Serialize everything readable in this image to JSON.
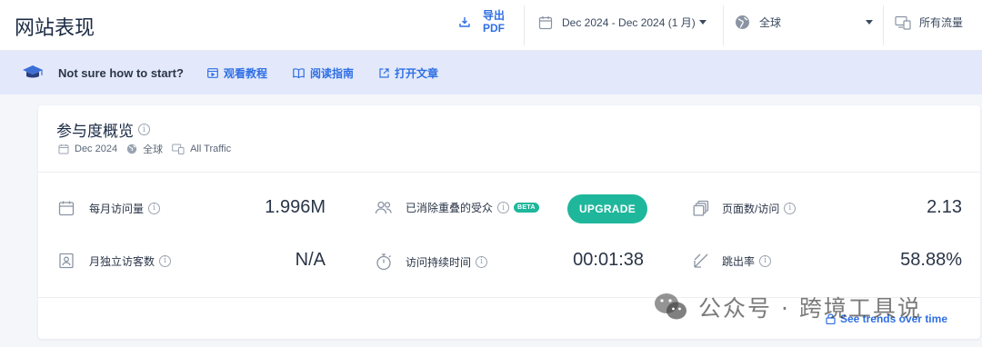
{
  "header": {
    "title": "网站表现",
    "export_label_line1": "导出",
    "export_label_line2": "PDF",
    "date_range": "Dec 2024 - Dec 2024 (1 月)",
    "country": "全球",
    "traffic": "所有流量"
  },
  "banner": {
    "question": "Not sure how to start?",
    "links": [
      "观看教程",
      "阅读指南",
      "打开文章"
    ]
  },
  "card": {
    "title": "参与度概览",
    "meta": {
      "date": "Dec 2024",
      "country": "全球",
      "traffic": "All Traffic"
    },
    "metrics": {
      "monthly_visits": {
        "label": "每月访问量",
        "value": "1.996M"
      },
      "unique_visitors": {
        "label": "月独立访客数",
        "value": "N/A"
      },
      "dedup_audience": {
        "label": "已消除重叠的受众",
        "badge": "BETA",
        "button": "UPGRADE"
      },
      "visit_duration": {
        "label": "访问持续时间",
        "value": "00:01:38"
      },
      "pages_per_visit": {
        "label": "页面数/访问",
        "value": "2.13"
      },
      "bounce_rate": {
        "label": "跳出率",
        "value": "58.88%"
      }
    },
    "trends_link": "See trends over time"
  },
  "watermark": "公众号 · 跨境工具说",
  "colors": {
    "accent": "#2f6fe4",
    "upgrade": "#1fb79c",
    "banner_bg": "#e3e9fb"
  }
}
